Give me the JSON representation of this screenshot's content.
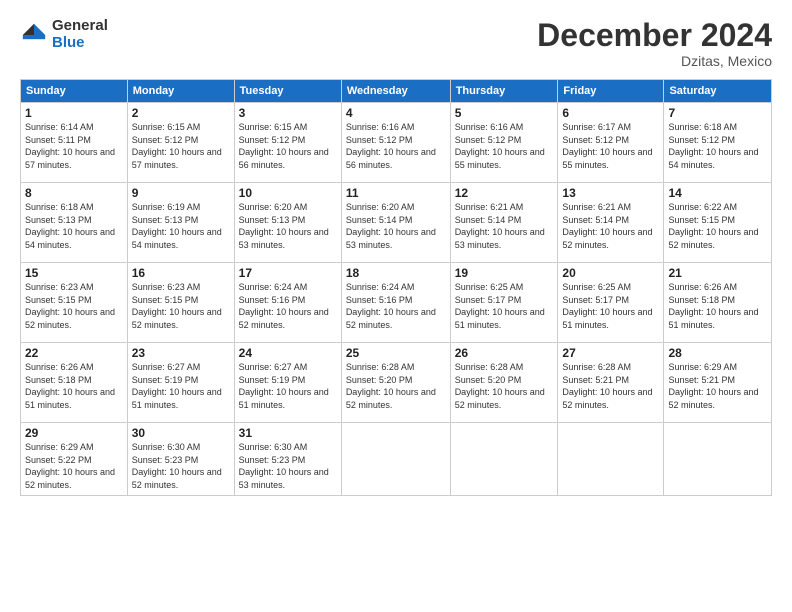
{
  "logo": {
    "general": "General",
    "blue": "Blue"
  },
  "title": "December 2024",
  "location": "Dzitas, Mexico",
  "days_of_week": [
    "Sunday",
    "Monday",
    "Tuesday",
    "Wednesday",
    "Thursday",
    "Friday",
    "Saturday"
  ],
  "weeks": [
    [
      {
        "day": "1",
        "sunrise": "6:14 AM",
        "sunset": "5:11 PM",
        "daylight": "10 hours and 57 minutes."
      },
      {
        "day": "2",
        "sunrise": "6:15 AM",
        "sunset": "5:12 PM",
        "daylight": "10 hours and 57 minutes."
      },
      {
        "day": "3",
        "sunrise": "6:15 AM",
        "sunset": "5:12 PM",
        "daylight": "10 hours and 56 minutes."
      },
      {
        "day": "4",
        "sunrise": "6:16 AM",
        "sunset": "5:12 PM",
        "daylight": "10 hours and 56 minutes."
      },
      {
        "day": "5",
        "sunrise": "6:16 AM",
        "sunset": "5:12 PM",
        "daylight": "10 hours and 55 minutes."
      },
      {
        "day": "6",
        "sunrise": "6:17 AM",
        "sunset": "5:12 PM",
        "daylight": "10 hours and 55 minutes."
      },
      {
        "day": "7",
        "sunrise": "6:18 AM",
        "sunset": "5:12 PM",
        "daylight": "10 hours and 54 minutes."
      }
    ],
    [
      {
        "day": "8",
        "sunrise": "6:18 AM",
        "sunset": "5:13 PM",
        "daylight": "10 hours and 54 minutes."
      },
      {
        "day": "9",
        "sunrise": "6:19 AM",
        "sunset": "5:13 PM",
        "daylight": "10 hours and 54 minutes."
      },
      {
        "day": "10",
        "sunrise": "6:20 AM",
        "sunset": "5:13 PM",
        "daylight": "10 hours and 53 minutes."
      },
      {
        "day": "11",
        "sunrise": "6:20 AM",
        "sunset": "5:14 PM",
        "daylight": "10 hours and 53 minutes."
      },
      {
        "day": "12",
        "sunrise": "6:21 AM",
        "sunset": "5:14 PM",
        "daylight": "10 hours and 53 minutes."
      },
      {
        "day": "13",
        "sunrise": "6:21 AM",
        "sunset": "5:14 PM",
        "daylight": "10 hours and 52 minutes."
      },
      {
        "day": "14",
        "sunrise": "6:22 AM",
        "sunset": "5:15 PM",
        "daylight": "10 hours and 52 minutes."
      }
    ],
    [
      {
        "day": "15",
        "sunrise": "6:23 AM",
        "sunset": "5:15 PM",
        "daylight": "10 hours and 52 minutes."
      },
      {
        "day": "16",
        "sunrise": "6:23 AM",
        "sunset": "5:15 PM",
        "daylight": "10 hours and 52 minutes."
      },
      {
        "day": "17",
        "sunrise": "6:24 AM",
        "sunset": "5:16 PM",
        "daylight": "10 hours and 52 minutes."
      },
      {
        "day": "18",
        "sunrise": "6:24 AM",
        "sunset": "5:16 PM",
        "daylight": "10 hours and 52 minutes."
      },
      {
        "day": "19",
        "sunrise": "6:25 AM",
        "sunset": "5:17 PM",
        "daylight": "10 hours and 51 minutes."
      },
      {
        "day": "20",
        "sunrise": "6:25 AM",
        "sunset": "5:17 PM",
        "daylight": "10 hours and 51 minutes."
      },
      {
        "day": "21",
        "sunrise": "6:26 AM",
        "sunset": "5:18 PM",
        "daylight": "10 hours and 51 minutes."
      }
    ],
    [
      {
        "day": "22",
        "sunrise": "6:26 AM",
        "sunset": "5:18 PM",
        "daylight": "10 hours and 51 minutes."
      },
      {
        "day": "23",
        "sunrise": "6:27 AM",
        "sunset": "5:19 PM",
        "daylight": "10 hours and 51 minutes."
      },
      {
        "day": "24",
        "sunrise": "6:27 AM",
        "sunset": "5:19 PM",
        "daylight": "10 hours and 51 minutes."
      },
      {
        "day": "25",
        "sunrise": "6:28 AM",
        "sunset": "5:20 PM",
        "daylight": "10 hours and 52 minutes."
      },
      {
        "day": "26",
        "sunrise": "6:28 AM",
        "sunset": "5:20 PM",
        "daylight": "10 hours and 52 minutes."
      },
      {
        "day": "27",
        "sunrise": "6:28 AM",
        "sunset": "5:21 PM",
        "daylight": "10 hours and 52 minutes."
      },
      {
        "day": "28",
        "sunrise": "6:29 AM",
        "sunset": "5:21 PM",
        "daylight": "10 hours and 52 minutes."
      }
    ],
    [
      {
        "day": "29",
        "sunrise": "6:29 AM",
        "sunset": "5:22 PM",
        "daylight": "10 hours and 52 minutes."
      },
      {
        "day": "30",
        "sunrise": "6:30 AM",
        "sunset": "5:23 PM",
        "daylight": "10 hours and 52 minutes."
      },
      {
        "day": "31",
        "sunrise": "6:30 AM",
        "sunset": "5:23 PM",
        "daylight": "10 hours and 53 minutes."
      },
      null,
      null,
      null,
      null
    ]
  ]
}
